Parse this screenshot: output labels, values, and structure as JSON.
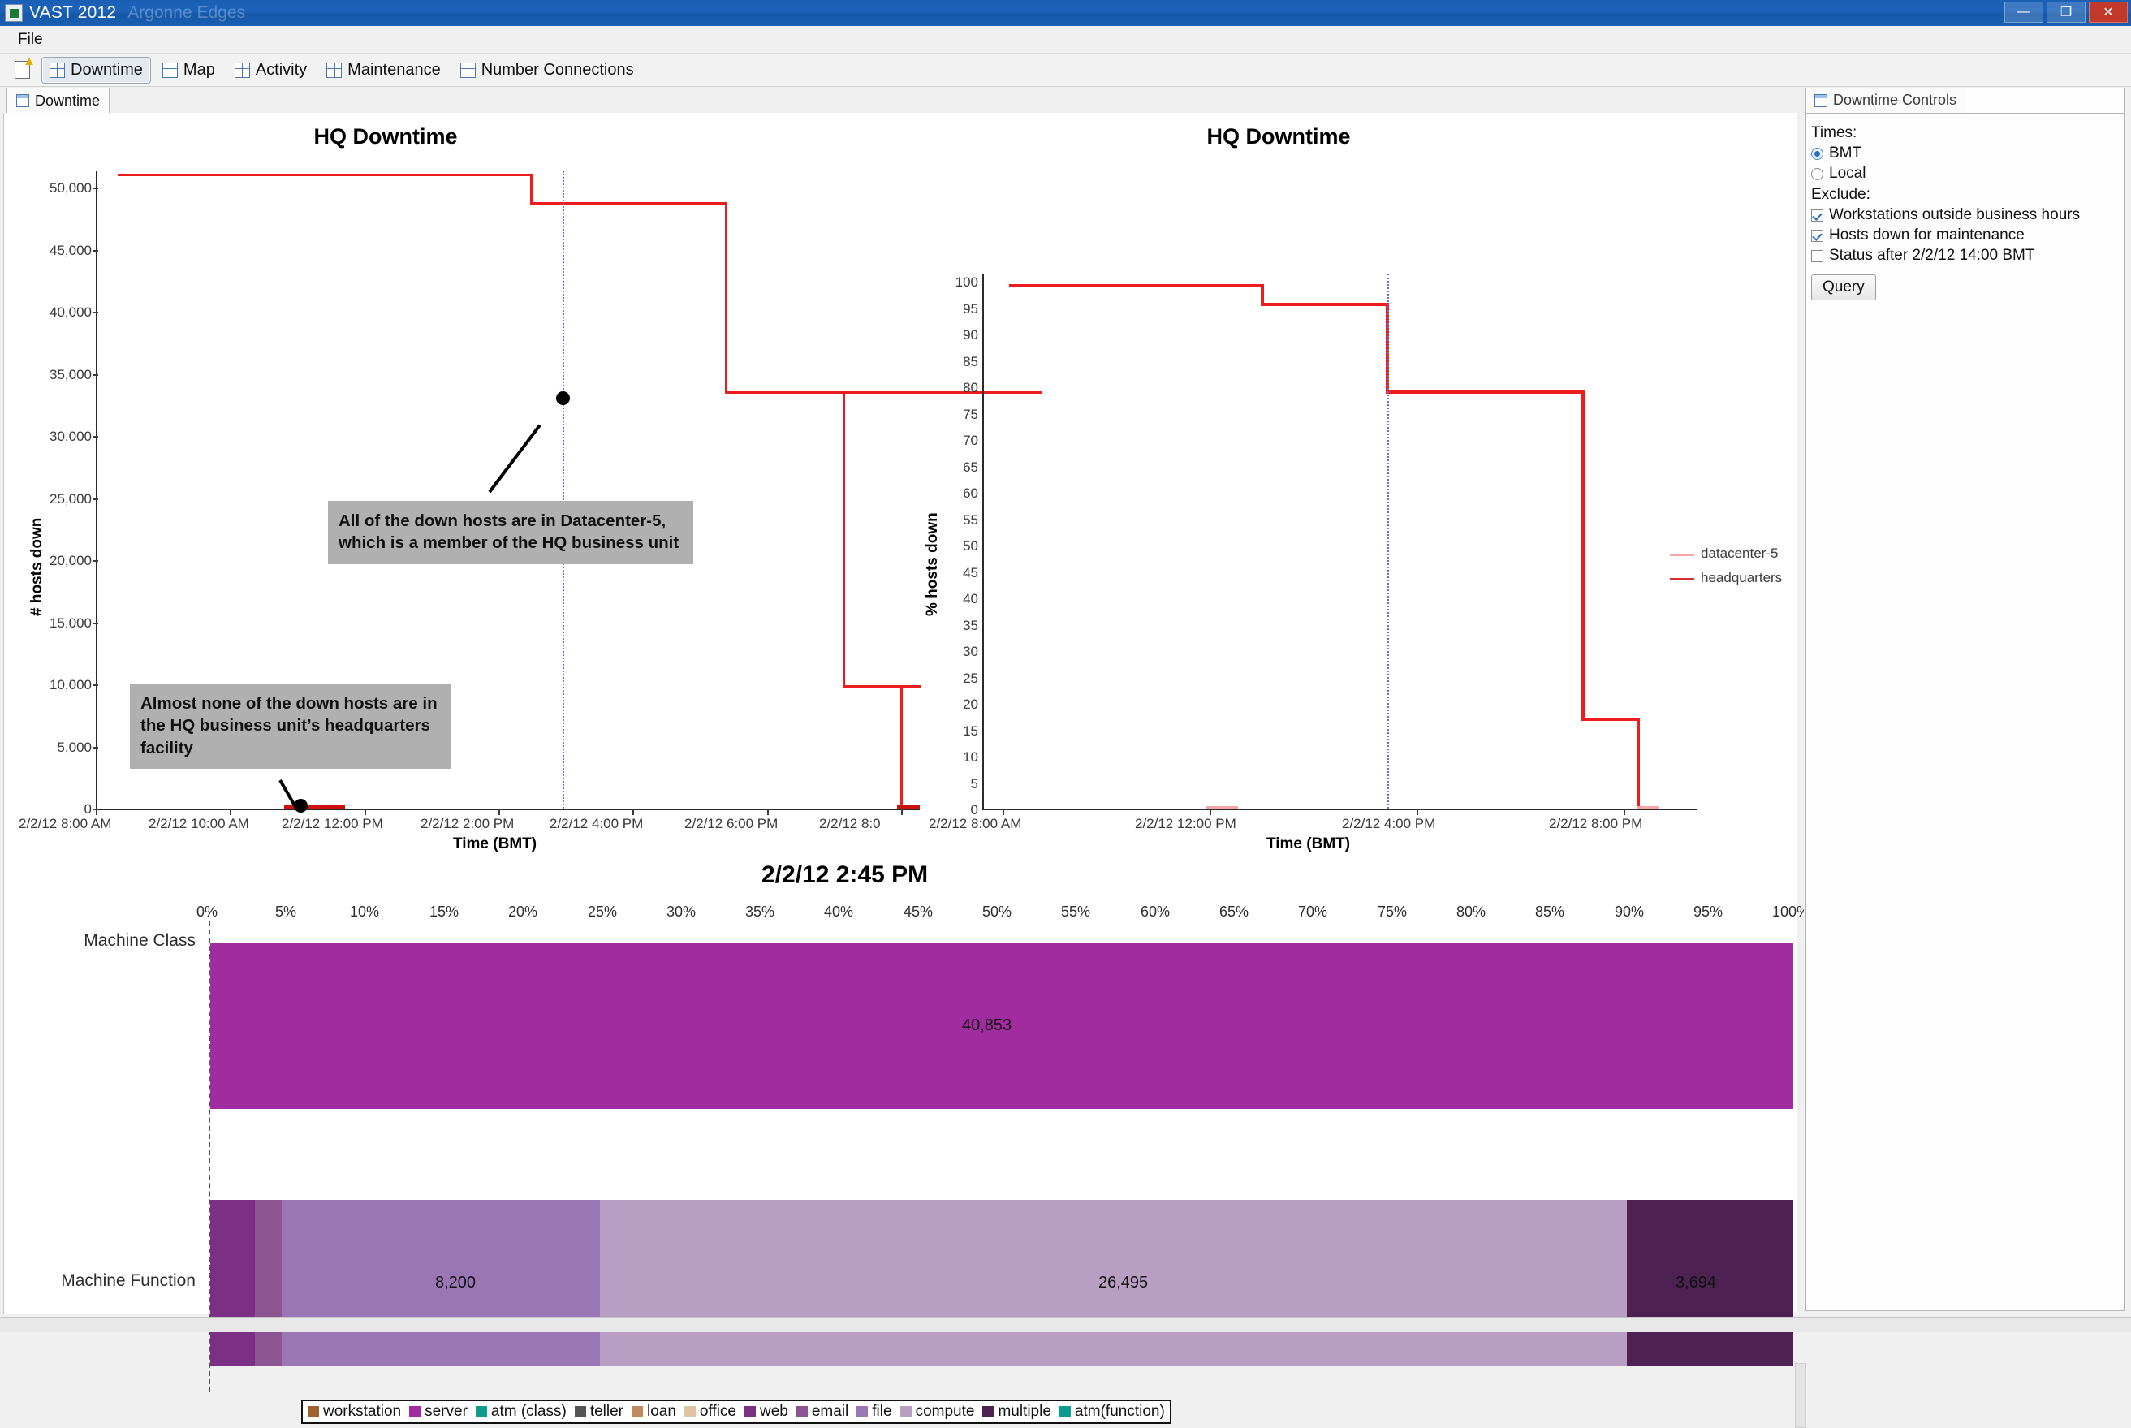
{
  "window": {
    "title": "VAST 2012",
    "title_faded": "Argonne Edges",
    "buttons": {
      "minimize": "—",
      "maximize": "❐",
      "close": "✕"
    }
  },
  "menubar": {
    "items": [
      "File"
    ]
  },
  "toolbar": {
    "new_icon": "new-document-icon",
    "items": [
      {
        "label": "Downtime",
        "icon": "grid-icon",
        "active": true
      },
      {
        "label": "Map",
        "icon": "grid-icon",
        "active": false
      },
      {
        "label": "Activity",
        "icon": "grid-icon",
        "active": false
      },
      {
        "label": "Maintenance",
        "icon": "grid-icon",
        "active": false
      },
      {
        "label": "Number Connections",
        "icon": "grid-icon",
        "active": false
      }
    ]
  },
  "document_tab": {
    "label": "Downtime",
    "icon": "window-icon"
  },
  "dock": {
    "tab_label": "Downtime Controls",
    "tab_icon": "window-icon",
    "times_label": "Times:",
    "time_options": [
      {
        "label": "BMT",
        "selected": true
      },
      {
        "label": "Local",
        "selected": false
      }
    ],
    "exclude_label": "Exclude:",
    "exclude_options": [
      {
        "label": "Workstations outside business hours",
        "checked": true
      },
      {
        "label": "Hosts down for maintenance",
        "checked": true
      },
      {
        "label": "Status after 2/2/12 14:00 BMT",
        "checked": false
      }
    ],
    "query_button": "Query"
  },
  "annotations": [
    {
      "id": "callout-datacenter5",
      "text": "All of the down hosts are in Datacenter-5, which is a member of the HQ business unit"
    },
    {
      "id": "callout-headquarters",
      "text": "Almost none of the down hosts are in the HQ business unit’s headquarters facility"
    }
  ],
  "colors": {
    "series_datacenter5": "#f7a6a6",
    "series_headquarters": "#ee1c1c",
    "cursor": "#6b6bd6",
    "callout_bg": "#b0b0b0",
    "workstation": "#a0622d",
    "server": "#a02ca0",
    "atm_class": "#0f9b8e",
    "teller": "#555555",
    "loan": "#c08a5e",
    "office": "#e0c3a0",
    "web": "#7b2f85",
    "email": "#8a5590",
    "file": "#9b76b5",
    "compute": "#b99ec4",
    "multiple": "#4d2252",
    "atm_function": "#0f9b8e"
  },
  "chart_data": [
    {
      "id": "hq-downtime-count",
      "type": "line",
      "title": "HQ Downtime",
      "xlabel": "Time (BMT)",
      "ylabel": "# hosts down",
      "ylim": [
        0,
        52000
      ],
      "yticks": [
        "0",
        "5,000",
        "10,000",
        "15,000",
        "20,000",
        "25,000",
        "30,000",
        "35,000",
        "40,000",
        "45,000",
        "50,000"
      ],
      "xticks": [
        "2/2/12 8:00 AM",
        "2/2/12 10:00 AM",
        "2/2/12 12:00 PM",
        "2/2/12 2:00 PM",
        "2/2/12 4:00 PM",
        "2/2/12 6:00 PM",
        "2/2/12 8:0"
      ],
      "cursor_x_label": "2/2/12 2:45 PM",
      "grid": false,
      "series": [
        {
          "name": "datacenter-5",
          "color": "#ee1c1c",
          "step_points": [
            {
              "x": "2/2/12 8:00 AM",
              "y": 51000
            },
            {
              "x": "2/2/12 12:30 PM",
              "y": 49300
            },
            {
              "x": "2/2/12 2:45 PM",
              "y": 40853
            },
            {
              "x": "2/2/12 6:15 PM",
              "y": 9400
            },
            {
              "x": "2/2/12 7:55 PM",
              "y": 200
            }
          ]
        },
        {
          "name": "headquarters",
          "color": "#ee1c1c",
          "step_points": [
            {
              "x": "2/2/12 8:00 AM",
              "y": 150
            },
            {
              "x": "2/2/12 8:00 PM",
              "y": 150
            }
          ]
        }
      ]
    },
    {
      "id": "hq-downtime-percent",
      "type": "line",
      "title": "HQ Downtime",
      "xlabel": "Time (BMT)",
      "ylabel": "% hosts down",
      "ylim": [
        0,
        100
      ],
      "yticks": [
        "0",
        "5",
        "10",
        "15",
        "20",
        "25",
        "30",
        "35",
        "40",
        "45",
        "50",
        "55",
        "60",
        "65",
        "70",
        "75",
        "80",
        "85",
        "90",
        "95",
        "100"
      ],
      "xticks": [
        "2/2/12 8:00 AM",
        "2/2/12 12:00 PM",
        "2/2/12 4:00 PM",
        "2/2/12 8:00 PM"
      ],
      "cursor_x_label": "2/2/12 2:45 PM",
      "grid": false,
      "legend": [
        "datacenter-5",
        "headquarters"
      ],
      "legend_position": "right",
      "series": [
        {
          "name": "datacenter-5",
          "color": "#f7a6a6",
          "step_points": [
            {
              "x": "2/2/12 8:00 AM",
              "y": 99
            },
            {
              "x": "2/2/12 12:30 PM",
              "y": 95
            },
            {
              "x": "2/2/12 2:45 PM",
              "y": 79
            },
            {
              "x": "2/2/12 6:15 PM",
              "y": 17
            },
            {
              "x": "2/2/12 7:55 PM",
              "y": 0
            }
          ]
        },
        {
          "name": "headquarters",
          "color": "#ee1c1c",
          "step_points": [
            {
              "x": "2/2/12 8:00 AM",
              "y": 0.4
            },
            {
              "x": "2/2/12 8:00 PM",
              "y": 0.4
            }
          ]
        }
      ]
    },
    {
      "id": "machine-breakdown",
      "type": "bar",
      "title": "2/2/12 2:45 PM",
      "orientation": "horizontal-stacked",
      "xlabel": "",
      "xticks": [
        "0%",
        "5%",
        "10%",
        "15%",
        "20%",
        "25%",
        "30%",
        "35%",
        "40%",
        "45%",
        "50%",
        "55%",
        "60%",
        "65%",
        "70%",
        "75%",
        "80%",
        "85%",
        "90%",
        "95%",
        "100%"
      ],
      "xlim": [
        0,
        100
      ],
      "categories": [
        "Machine Class",
        "Machine Function"
      ],
      "legend": [
        {
          "label": "workstation",
          "color": "#a0622d"
        },
        {
          "label": "server",
          "color": "#a02ca0"
        },
        {
          "label": "atm (class)",
          "color": "#0f9b8e"
        },
        {
          "label": "teller",
          "color": "#555555"
        },
        {
          "label": "loan",
          "color": "#c08a5e"
        },
        {
          "label": "office",
          "color": "#e0c3a0"
        },
        {
          "label": "web",
          "color": "#7b2f85"
        },
        {
          "label": "email",
          "color": "#8a5590"
        },
        {
          "label": "file",
          "color": "#9b76b5"
        },
        {
          "label": "compute",
          "color": "#b99ec4"
        },
        {
          "label": "multiple",
          "color": "#4d2252"
        },
        {
          "label": "atm(function)",
          "color": "#0f9b8e"
        }
      ],
      "rows": [
        {
          "name": "Machine Class",
          "segments": [
            {
              "label": "server",
              "color": "#a02ca0",
              "pct": 100.0,
              "value": "40,853"
            }
          ]
        },
        {
          "name": "Machine Function",
          "segments": [
            {
              "label": "web",
              "color": "#7b2f85",
              "pct": 2.8,
              "value": ""
            },
            {
              "label": "email",
              "color": "#8a5590",
              "pct": 1.7,
              "value": ""
            },
            {
              "label": "file",
              "color": "#9b76b5",
              "pct": 20.1,
              "value": "8,200"
            },
            {
              "label": "compute",
              "color": "#b99ec4",
              "pct": 64.9,
              "value": "26,495"
            },
            {
              "label": "multiple",
              "color": "#4d2252",
              "pct": 10.5,
              "value": "3,694"
            }
          ]
        }
      ]
    }
  ]
}
